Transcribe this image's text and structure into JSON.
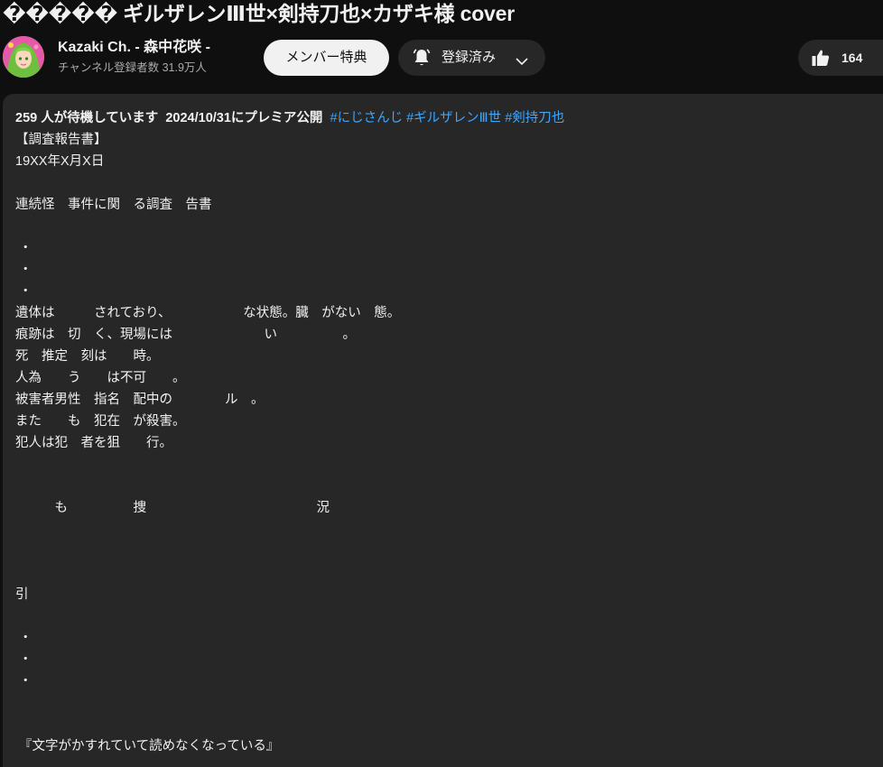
{
  "video": {
    "title": "����� ギルザレンⅢ世×剣持刀也×カザキ様 cover"
  },
  "channel": {
    "name": "Kazaki Ch. - 森中花咲 -",
    "subscribers": "チャンネル登録者数 31.9万人",
    "avatar_icon": "channel-avatar"
  },
  "actions": {
    "member_label": "メンバー特典",
    "subscribed_label": "登録済み",
    "bell_icon": "bell-icon",
    "chevron_icon": "chevron-down-icon",
    "like_icon": "thumbs-up-icon",
    "like_count": "164"
  },
  "description": {
    "waiting": "259 人が待機しています",
    "premiere": "2024/10/31にプレミア公開",
    "hashtags": [
      "#にじさんじ",
      "#ギルザレンⅢ世",
      "#剣持刀也"
    ],
    "body": "【調査報告書】\n19XX年X月X日\n\n連続怪　事件に関　る調査　告書\n\n ・\n ・\n ・\n遺体は　　　されており、　　　　　　な状態。臓　がない　態。\n痕跡は　切　く、現場には　　　　　　　い　　　　　。\n死　推定　刻は　　時。\n人為　　う　　は不可　　。\n被害者男性　指名　配中の　　　　ル　。\nまた　　も　犯在　が殺害。\n犯人は犯　者を狙　　行。\n\n\n　　　も　　　　　捜　　　　　　　　　　　　　況\n\n\n\n引\n\n ・\n ・\n ・\n\n\n 『文字がかすれていて読めなくなっている』"
  },
  "colors": {
    "background": "#0f0f0f",
    "panel": "#272727",
    "link": "#3ea6ff",
    "text": "#f1f1f1",
    "secondary_text": "#aaaaaa"
  }
}
